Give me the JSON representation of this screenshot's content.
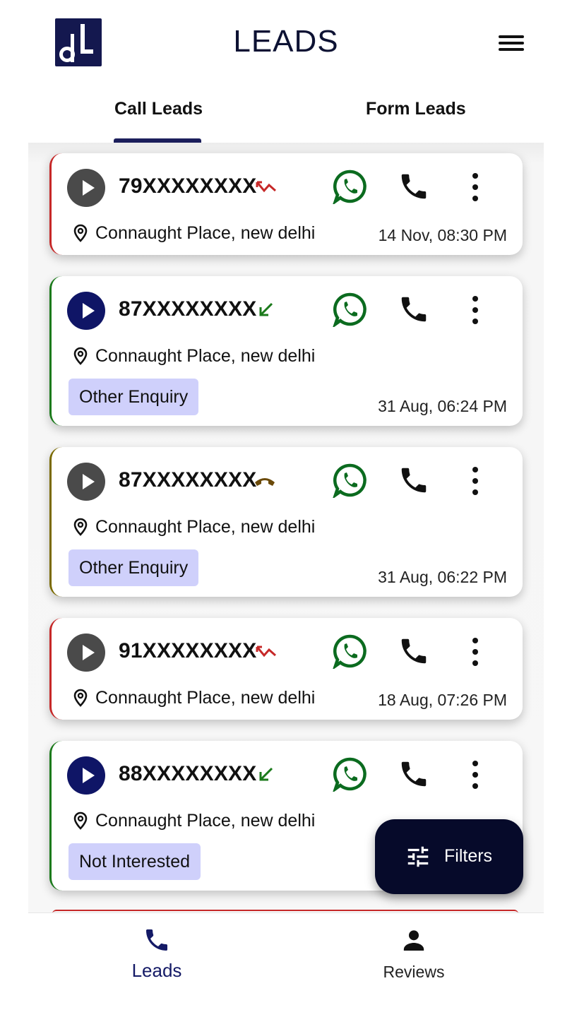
{
  "header": {
    "title": "LEADS",
    "logo_icon": "brand-logo",
    "menu_icon": "hamburger-menu-icon"
  },
  "tabs": [
    {
      "label": "Call Leads",
      "active": true
    },
    {
      "label": "Form Leads",
      "active": false
    }
  ],
  "colors": {
    "primary": "#0f1566",
    "missed": "#c62828",
    "answered": "#1b7a1b",
    "ended": "#7a6a00",
    "whatsapp": "#0b6b1f",
    "tag_bg": "#cfd0fb"
  },
  "leads": [
    {
      "phone": "79XXXXXXXX",
      "call_status": "missed",
      "location": "Connaught Place, new delhi",
      "tag": "",
      "time": "14 Nov, 08:30 PM",
      "played": false
    },
    {
      "phone": "87XXXXXXXX",
      "call_status": "answered",
      "location": "Connaught Place, new delhi",
      "tag": "Other Enquiry",
      "time": "31 Aug, 06:24 PM",
      "played": true
    },
    {
      "phone": "87XXXXXXXX",
      "call_status": "ended",
      "location": "Connaught Place, new delhi",
      "tag": "Other Enquiry",
      "time": "31 Aug, 06:22 PM",
      "played": false
    },
    {
      "phone": "91XXXXXXXX",
      "call_status": "missed",
      "location": "Connaught Place, new delhi",
      "tag": "",
      "time": "18 Aug, 07:26 PM",
      "played": false
    },
    {
      "phone": "88XXXXXXXX",
      "call_status": "answered",
      "location": "Connaught Place, new delhi",
      "tag": "Not Interested",
      "time": "",
      "played": true
    }
  ],
  "filters_button": {
    "label": "Filters",
    "icon": "tune-icon"
  },
  "bottom_nav": [
    {
      "label": "Leads",
      "icon": "phone-icon",
      "active": true
    },
    {
      "label": "Reviews",
      "icon": "person-icon",
      "active": false
    }
  ]
}
